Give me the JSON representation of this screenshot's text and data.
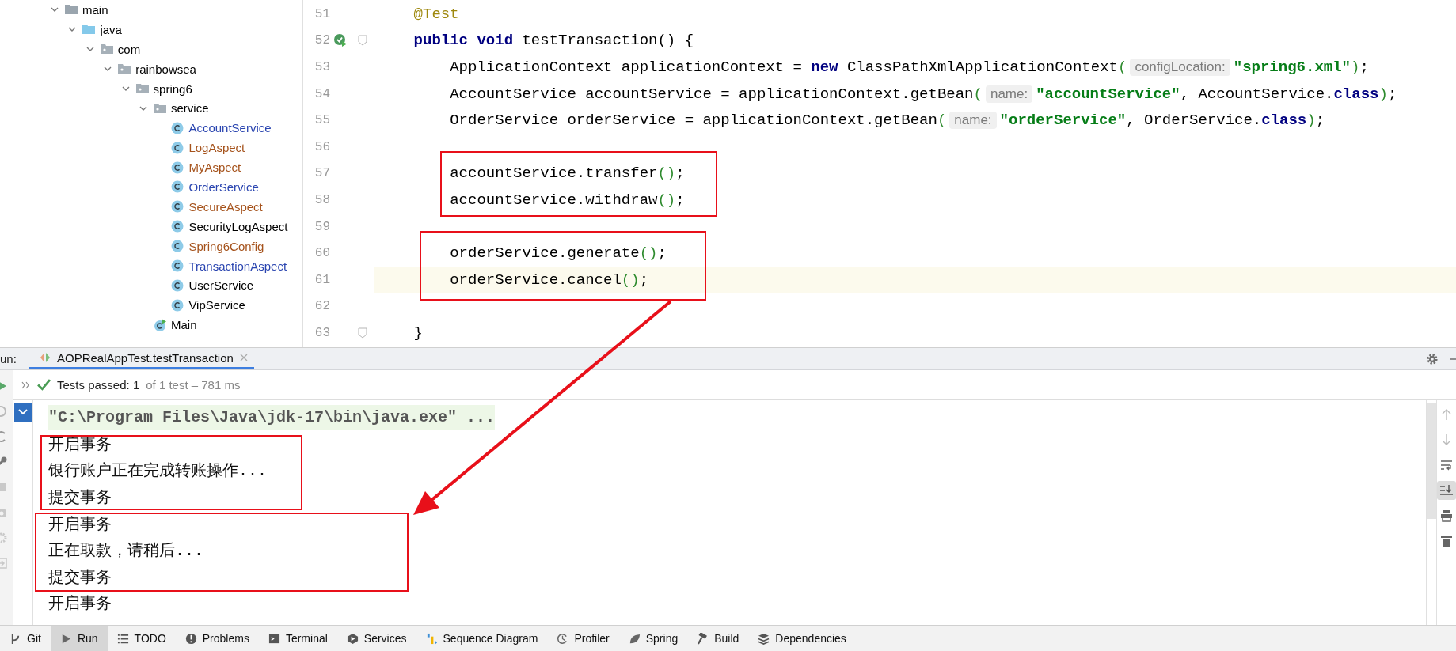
{
  "tree": [
    {
      "label": "main",
      "kind": "folder",
      "expanded": true,
      "children": [
        {
          "label": "java",
          "kind": "source-root",
          "expanded": true,
          "children": [
            {
              "label": "com",
              "kind": "package",
              "expanded": true,
              "children": [
                {
                  "label": "rainbowsea",
                  "kind": "package",
                  "expanded": true,
                  "children": [
                    {
                      "label": "spring6",
                      "kind": "package",
                      "expanded": true,
                      "children": [
                        {
                          "label": "service",
                          "kind": "package",
                          "expanded": true,
                          "children": [
                            {
                              "label": "AccountService",
                              "kind": "class",
                              "color": "#2a45b0"
                            },
                            {
                              "label": "LogAspect",
                              "kind": "class",
                              "color": "#a5521b"
                            },
                            {
                              "label": "MyAspect",
                              "kind": "class",
                              "color": "#a5521b"
                            },
                            {
                              "label": "OrderService",
                              "kind": "class",
                              "color": "#2a45b0"
                            },
                            {
                              "label": "SecureAspect",
                              "kind": "class",
                              "color": "#a5521b"
                            },
                            {
                              "label": "SecurityLogAspect",
                              "kind": "class",
                              "color": "#000000"
                            },
                            {
                              "label": "Spring6Config",
                              "kind": "class",
                              "color": "#a5521b"
                            },
                            {
                              "label": "TransactionAspect",
                              "kind": "class",
                              "color": "#2a45b0"
                            },
                            {
                              "label": "UserService",
                              "kind": "class",
                              "color": "#000000"
                            },
                            {
                              "label": "VipService",
                              "kind": "class",
                              "color": "#000000"
                            }
                          ]
                        },
                        {
                          "label": "Main",
                          "kind": "runnable-class",
                          "color": "#000000"
                        }
                      ]
                    }
                  ]
                }
              ]
            }
          ]
        }
      ]
    }
  ],
  "editor": {
    "lines": [
      {
        "number": "51",
        "current": false,
        "runs": [
          {
            "kind": "code",
            "tokens": [
              {
                "kind": "annotation",
                "text": "    @Test"
              }
            ]
          }
        ]
      },
      {
        "number": "52",
        "current": false,
        "run_icon": true,
        "fold": true,
        "runs": [
          {
            "kind": "code",
            "tokens": [
              {
                "kind": "keyword",
                "text": "    public void"
              },
              {
                "kind": "text",
                "text": " testTransaction() {"
              }
            ]
          }
        ]
      },
      {
        "number": "53",
        "current": false,
        "runs": [
          {
            "kind": "code",
            "tokens": [
              {
                "kind": "text",
                "text": "        ApplicationContext applicationContext = "
              },
              {
                "kind": "keyword",
                "text": "new"
              },
              {
                "kind": "text",
                "text": " ClassPathXmlApplicationContext"
              },
              {
                "kind": "bracket",
                "text": "("
              }
            ]
          },
          {
            "kind": "hint",
            "text": "configLocation:"
          },
          {
            "kind": "code",
            "tokens": [
              {
                "kind": "string",
                "text": "\"spring6.xml\""
              },
              {
                "kind": "bracket",
                "text": ")"
              },
              {
                "kind": "text",
                "text": ";"
              }
            ]
          }
        ]
      },
      {
        "number": "54",
        "current": false,
        "runs": [
          {
            "kind": "code",
            "tokens": [
              {
                "kind": "text",
                "text": "        AccountService accountService = applicationContext.getBean"
              },
              {
                "kind": "bracket",
                "text": "("
              }
            ]
          },
          {
            "kind": "hint",
            "text": "name:"
          },
          {
            "kind": "code",
            "tokens": [
              {
                "kind": "string",
                "text": "\"accountService\""
              },
              {
                "kind": "text",
                "text": ", AccountService."
              },
              {
                "kind": "keyword",
                "text": "class"
              },
              {
                "kind": "bracket",
                "text": ")"
              },
              {
                "kind": "text",
                "text": ";"
              }
            ]
          }
        ]
      },
      {
        "number": "55",
        "current": false,
        "runs": [
          {
            "kind": "code",
            "tokens": [
              {
                "kind": "text",
                "text": "        OrderService orderService = applicationContext.getBean"
              },
              {
                "kind": "bracket",
                "text": "("
              }
            ]
          },
          {
            "kind": "hint",
            "text": "name:"
          },
          {
            "kind": "code",
            "tokens": [
              {
                "kind": "string",
                "text": "\"orderService\""
              },
              {
                "kind": "text",
                "text": ", OrderService."
              },
              {
                "kind": "keyword",
                "text": "class"
              },
              {
                "kind": "bracket",
                "text": ")"
              },
              {
                "kind": "text",
                "text": ";"
              }
            ]
          }
        ]
      },
      {
        "number": "56",
        "current": false
      },
      {
        "number": "57",
        "current": false,
        "runs": [
          {
            "kind": "code",
            "tokens": [
              {
                "kind": "text",
                "text": "        accountService.transfer"
              },
              {
                "kind": "bracket",
                "text": "()"
              },
              {
                "kind": "text",
                "text": ";"
              }
            ]
          }
        ]
      },
      {
        "number": "58",
        "current": false,
        "runs": [
          {
            "kind": "code",
            "tokens": [
              {
                "kind": "text",
                "text": "        accountService.withdraw"
              },
              {
                "kind": "bracket",
                "text": "()"
              },
              {
                "kind": "text",
                "text": ";"
              }
            ]
          }
        ]
      },
      {
        "number": "59",
        "current": false
      },
      {
        "number": "60",
        "current": false,
        "runs": [
          {
            "kind": "code",
            "tokens": [
              {
                "kind": "text",
                "text": "        orderService.generate"
              },
              {
                "kind": "bracket",
                "text": "()"
              },
              {
                "kind": "text",
                "text": ";"
              }
            ]
          }
        ]
      },
      {
        "number": "61",
        "current": true,
        "runs": [
          {
            "kind": "code",
            "tokens": [
              {
                "kind": "text",
                "text": "        orderService.cancel"
              },
              {
                "kind": "bracket",
                "text": "()"
              },
              {
                "kind": "text",
                "text": ";"
              }
            ]
          }
        ]
      },
      {
        "number": "62",
        "current": false
      },
      {
        "number": "63",
        "current": false,
        "fold": true,
        "runs": [
          {
            "kind": "code",
            "tokens": [
              {
                "kind": "text",
                "text": "    }"
              }
            ]
          }
        ]
      }
    ]
  },
  "run_panel": {
    "label": "un:",
    "tabs": [
      {
        "label": "AOPRealAppTest.testTransaction",
        "selected": true
      }
    ],
    "status": {
      "label": "Tests passed: 1",
      "detail": "of 1 test – 781 ms"
    },
    "console": [
      {
        "kind": "command",
        "text": "\"C:\\Program Files\\Java\\jdk-17\\bin\\java.exe\" ..."
      },
      {
        "kind": "output",
        "text": "开启事务"
      },
      {
        "kind": "output",
        "text": "银行账户正在完成转账操作..."
      },
      {
        "kind": "output",
        "text": "提交事务"
      },
      {
        "kind": "output",
        "text": "开启事务"
      },
      {
        "kind": "output",
        "text": "正在取款，请稍后..."
      },
      {
        "kind": "output",
        "text": "提交事务"
      },
      {
        "kind": "output",
        "text": "开启事务"
      }
    ]
  },
  "tool_windows": [
    {
      "label": "Git",
      "selected": false
    },
    {
      "label": "Run",
      "selected": true
    },
    {
      "label": "TODO",
      "selected": false
    },
    {
      "label": "Problems",
      "selected": false
    },
    {
      "label": "Terminal",
      "selected": false
    },
    {
      "label": "Services",
      "selected": false
    },
    {
      "label": "Sequence Diagram",
      "selected": false
    },
    {
      "label": "Profiler",
      "selected": false
    },
    {
      "label": "Spring",
      "selected": false
    },
    {
      "label": "Build",
      "selected": false
    },
    {
      "label": "Dependencies",
      "selected": false
    }
  ]
}
